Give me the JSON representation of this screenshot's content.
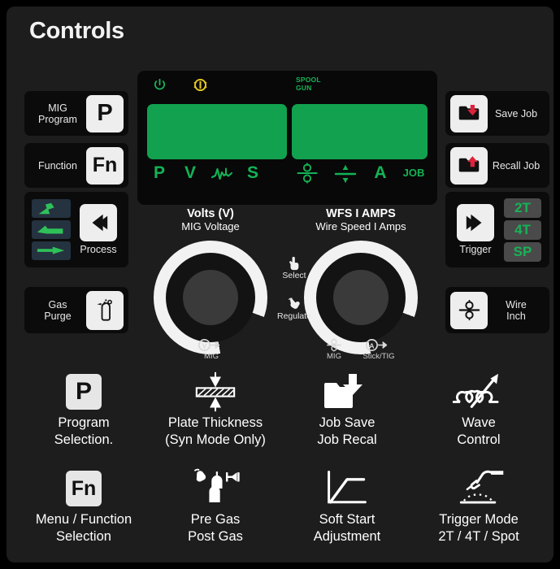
{
  "header": {
    "title": "Controls"
  },
  "colors": {
    "panel_bg": "#1d1d1d",
    "display_green": "#12a24f",
    "lamp_green": "#13b355",
    "warn_yellow": "#e8c81e",
    "keycap": "#eeeeee",
    "tile_bg": "#0b0b0b"
  },
  "display": {
    "power_icon": "power-icon",
    "warning_icon": "thermal-warning-icon",
    "spool_label_line1": "SPOOL",
    "spool_label_line2": "GUN",
    "left_readout_value": "",
    "right_readout_value": "",
    "indicators_left": [
      {
        "label": "P",
        "name": "indicator-program"
      },
      {
        "label": "V",
        "name": "indicator-volts"
      },
      {
        "label": "",
        "name": "indicator-inductance-icon"
      },
      {
        "label": "S",
        "name": "indicator-seconds"
      }
    ],
    "indicators_right": [
      {
        "label": "",
        "name": "indicator-wire-speed-icon"
      },
      {
        "label": "",
        "name": "indicator-plate-thickness-icon"
      },
      {
        "label": "A",
        "name": "indicator-amps"
      },
      {
        "label": "JOB",
        "name": "indicator-job"
      }
    ]
  },
  "left_buttons": [
    {
      "name": "mig-program-button",
      "label_line1": "MIG",
      "label_line2": "Program",
      "keycap": "P",
      "icon": "letter-p-keycap"
    },
    {
      "name": "function-button",
      "label_line1": "Function",
      "label_line2": "",
      "keycap": "Fn",
      "icon": "letter-fn-keycap"
    },
    {
      "name": "process-button",
      "label_line1": "Process",
      "label_line2": "",
      "keycap": "",
      "icon": "left-triangle-icon"
    },
    {
      "name": "gas-purge-button",
      "label_line1": "Gas",
      "label_line2": "Purge",
      "keycap": "",
      "icon": "gas-bottle-icon"
    }
  ],
  "process_modes": [
    {
      "name": "process-mode-mig-icon"
    },
    {
      "name": "process-mode-stick-icon"
    },
    {
      "name": "process-mode-tig-icon"
    }
  ],
  "right_buttons": [
    {
      "name": "save-job-button",
      "label": "Save Job",
      "icon": "folder-down-arrow-icon"
    },
    {
      "name": "recall-job-button",
      "label": "Recall Job",
      "icon": "folder-up-arrow-icon"
    },
    {
      "name": "trigger-button",
      "label": "Trigger",
      "icon": "right-triangle-icon"
    },
    {
      "name": "wire-inch-button",
      "label_line1": "Wire",
      "label_line2": "Inch",
      "icon": "wire-rollers-icon"
    }
  ],
  "trigger_modes": [
    {
      "name": "trigger-mode-2t",
      "label": "2T"
    },
    {
      "name": "trigger-mode-4t",
      "label": "4T"
    },
    {
      "name": "trigger-mode-sp",
      "label": "SP"
    }
  ],
  "knobs": {
    "left": {
      "name": "volts-knob",
      "title": "Volts (V)",
      "subtitle": "MIG Voltage",
      "foot_icon": "volts-mig-icon",
      "foot_label": "MIG"
    },
    "right": {
      "name": "wfs-amps-knob",
      "title": "WFS I AMPS",
      "subtitle": "Wire Speed I Amps",
      "foot_icon_1": "wire-speed-mig-icon",
      "foot_label_1": "MIG",
      "foot_icon_2": "amps-stick-tig-icon",
      "foot_label_2": "Stick/TIG"
    },
    "center": [
      {
        "name": "select-action",
        "label": "Select",
        "icon": "hand-press-icon"
      },
      {
        "name": "regulate-action",
        "label": "Regulate",
        "icon": "hand-rotate-icon"
      }
    ]
  },
  "legend": [
    {
      "name": "legend-program-selection",
      "icon": "letter-p-keycap",
      "line1": "Program",
      "line2": "Selection."
    },
    {
      "name": "legend-plate-thickness",
      "icon": "plate-thickness-icon",
      "line1": "Plate Thickness",
      "line2": "(Syn Mode Only)"
    },
    {
      "name": "legend-job-save-recall",
      "icon": "folder-down-arrow-icon",
      "line1": "Job Save",
      "line2": "Job Recal"
    },
    {
      "name": "legend-wave-control",
      "icon": "wave-arrow-icon",
      "line1": "Wave",
      "line2": "Control"
    },
    {
      "name": "legend-menu-function",
      "icon": "letter-fn-keycap",
      "line1": "Menu / Function",
      "line2": "Selection"
    },
    {
      "name": "legend-pre-post-gas",
      "icon": "gas-bottles-icon",
      "line1": "Pre Gas",
      "line2": "Post Gas"
    },
    {
      "name": "legend-soft-start",
      "icon": "soft-start-curve-icon",
      "line1": "Soft Start",
      "line2": "Adjustment"
    },
    {
      "name": "legend-trigger-mode",
      "icon": "welding-torch-icon",
      "line1": "Trigger Mode",
      "line2": "2T / 4T / Spot"
    }
  ]
}
